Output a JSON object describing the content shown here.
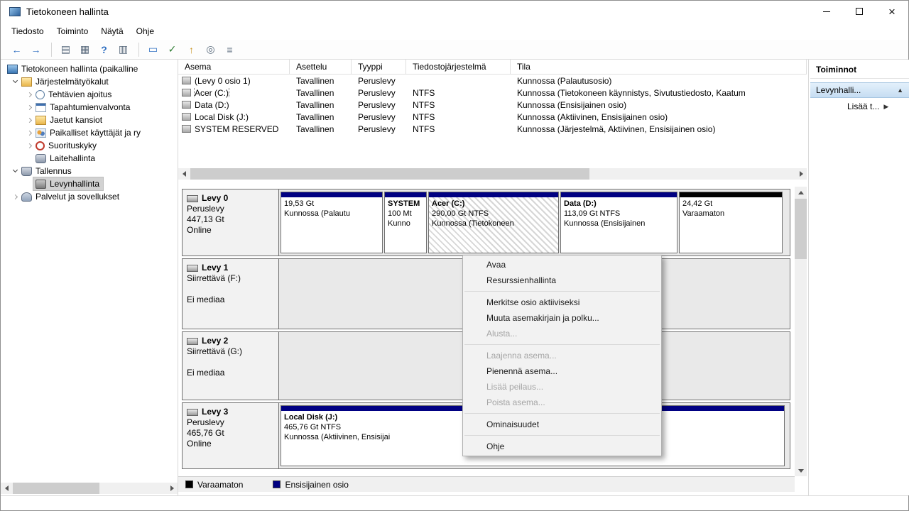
{
  "titlebar": {
    "title": "Tietokoneen hallinta"
  },
  "window_controls": {
    "minimize": "",
    "maximize": "",
    "close": "×"
  },
  "menubar": {
    "items": [
      "Tiedosto",
      "Toiminto",
      "Näytä",
      "Ohje"
    ]
  },
  "toolbar": {
    "icons": [
      {
        "name": "back",
        "glyph": "←"
      },
      {
        "name": "forward",
        "glyph": "→"
      },
      {
        "name": "console-tree",
        "glyph": "▤"
      },
      {
        "name": "export-list",
        "glyph": "▦"
      },
      {
        "name": "help",
        "glyph": "?"
      },
      {
        "name": "action-pane",
        "glyph": "▥"
      },
      {
        "name": "dialog",
        "glyph": "▭"
      },
      {
        "name": "check-document",
        "glyph": "✓"
      },
      {
        "name": "up-folder",
        "glyph": "↑"
      },
      {
        "name": "search-document",
        "glyph": "◎"
      },
      {
        "name": "list-view",
        "glyph": "≡"
      }
    ]
  },
  "tree": {
    "items": [
      {
        "label": "Tietokoneen hallinta (paikalline"
      },
      {
        "label": "Järjestelmätyökalut"
      },
      {
        "label": "Tehtävien ajoitus"
      },
      {
        "label": "Tapahtumienvalvonta"
      },
      {
        "label": "Jaetut kansiot"
      },
      {
        "label": "Paikalliset käyttäjät ja ry"
      },
      {
        "label": "Suorituskyky"
      },
      {
        "label": "Laitehallinta"
      },
      {
        "label": "Tallennus"
      },
      {
        "label": "Levynhallinta"
      },
      {
        "label": "Palvelut ja sovellukset"
      }
    ]
  },
  "volume_table": {
    "columns": [
      "Asema",
      "Asettelu",
      "Tyyppi",
      "Tiedostojärjestelmä",
      "Tila"
    ],
    "rows": [
      {
        "asema": "(Levy 0 osio 1)",
        "asettelu": "Tavallinen",
        "tyyppi": "Peruslevy",
        "fs": "",
        "tila": "Kunnossa (Palautusosio)"
      },
      {
        "asema": "Acer (C:)",
        "asettelu": "Tavallinen",
        "tyyppi": "Peruslevy",
        "fs": "NTFS",
        "tila": "Kunnossa (Tietokoneen käynnistys, Sivutustiedosto, Kaatum"
      },
      {
        "asema": "Data (D:)",
        "asettelu": "Tavallinen",
        "tyyppi": "Peruslevy",
        "fs": "NTFS",
        "tila": "Kunnossa (Ensisijainen osio)"
      },
      {
        "asema": "Local Disk (J:)",
        "asettelu": "Tavallinen",
        "tyyppi": "Peruslevy",
        "fs": "NTFS",
        "tila": "Kunnossa (Aktiivinen, Ensisijainen osio)"
      },
      {
        "asema": "SYSTEM RESERVED",
        "asettelu": "Tavallinen",
        "tyyppi": "Peruslevy",
        "fs": "NTFS",
        "tila": "Kunnossa (Järjestelmä, Aktiivinen, Ensisijainen osio)"
      }
    ]
  },
  "disks": [
    {
      "name": "Levy 0",
      "type": "Peruslevy",
      "size": "447,13 Gt",
      "status": "Online",
      "partitions": [
        {
          "name": "",
          "size": "19,53 Gt",
          "status": "Kunnossa (Palautu"
        },
        {
          "name": "SYSTEM",
          "size": "100 Mt",
          "status": "Kunno"
        },
        {
          "name": "Acer (C:)",
          "size": "290,00 Gt NTFS",
          "status": "Kunnossa (Tietokoneen"
        },
        {
          "name": "Data (D:)",
          "size": "113,09 Gt NTFS",
          "status": "Kunnossa (Ensisijainen"
        },
        {
          "name": "",
          "size": "24,42 Gt",
          "status": "Varaamaton"
        }
      ]
    },
    {
      "name": "Levy 1",
      "type": "Siirrettävä (F:)",
      "size": "",
      "status": "Ei mediaa",
      "partitions": []
    },
    {
      "name": "Levy 2",
      "type": "Siirrettävä (G:)",
      "size": "",
      "status": "Ei mediaa",
      "partitions": []
    },
    {
      "name": "Levy 3",
      "type": "Peruslevy",
      "size": "465,76 Gt",
      "status": "Online",
      "partitions": [
        {
          "name": "Local Disk (J:)",
          "size": "465,76 Gt NTFS",
          "status": "Kunnossa (Aktiivinen, Ensisijai"
        }
      ]
    }
  ],
  "legend": {
    "items": [
      {
        "label": "Varaamaton",
        "color": "#000000"
      },
      {
        "label": "Ensisijainen osio",
        "color": "#000082"
      }
    ]
  },
  "context_menu": {
    "items": [
      {
        "label": "Avaa",
        "enabled": true
      },
      {
        "label": "Resurssienhallinta",
        "enabled": true
      },
      {
        "label": "Merkitse osio aktiiviseksi",
        "enabled": true
      },
      {
        "label": "Muuta asemakirjain ja polku...",
        "enabled": true
      },
      {
        "label": "Alusta...",
        "enabled": false
      },
      {
        "label": "Laajenna asema...",
        "enabled": false
      },
      {
        "label": "Pienennä asema...",
        "enabled": true
      },
      {
        "label": "Lisää peilaus...",
        "enabled": false
      },
      {
        "label": "Poista asema...",
        "enabled": false
      },
      {
        "label": "Ominaisuudet",
        "enabled": true
      },
      {
        "label": "Ohje",
        "enabled": true
      }
    ]
  },
  "actions_panel": {
    "title": "Toiminnot",
    "group_label": "Levynhalli...",
    "group_arrow": "▲",
    "more_label": "Lisää t...",
    "more_arrow": "▶"
  }
}
